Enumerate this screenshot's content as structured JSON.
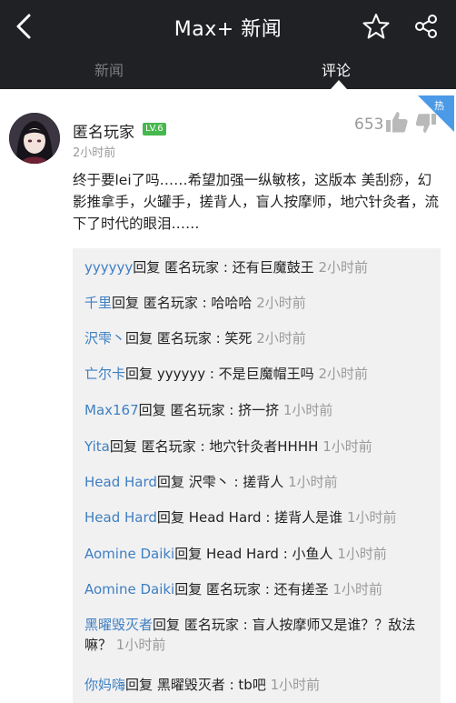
{
  "header": {
    "title": "Max+ 新闻",
    "tabs": [
      {
        "label": "新闻",
        "active": false
      },
      {
        "label": "评论",
        "active": true
      }
    ]
  },
  "comment": {
    "author": "匿名玩家",
    "level": "LV.6",
    "time": "2小时前",
    "likes": "653",
    "hot_label": "热",
    "body": "终于要lei了吗……希望加强一纵敏核，这版本 美刮痧，幻影推拿手，火罐手，搓背人，盲人按摩师，地穴针灸者，流下了时代的眼泪……"
  },
  "replies": [
    {
      "from": "yyyyyy",
      "verb": "回复",
      "to": "匿名玩家",
      "text": "还有巨魔鼓王",
      "time": "2小时前"
    },
    {
      "from": "千里",
      "verb": "回复",
      "to": "匿名玩家",
      "text": "哈哈哈",
      "time": "2小时前"
    },
    {
      "from": "沢雫丶",
      "verb": "回复",
      "to": "匿名玩家",
      "text": "笑死",
      "time": "2小时前"
    },
    {
      "from": "亡尔卡",
      "verb": "回复",
      "to": "yyyyyy",
      "text": "不是巨魔帽王吗",
      "time": "2小时前"
    },
    {
      "from": "Max167",
      "verb": "回复",
      "to": "匿名玩家",
      "text": "挤一挤",
      "time": "1小时前"
    },
    {
      "from": "Yita",
      "verb": "回复",
      "to": "匿名玩家",
      "text": "地穴针灸者HHHH",
      "time": "1小时前"
    },
    {
      "from": "Head Hard",
      "verb": "回复",
      "to": "沢雫丶",
      "text": "搓背人",
      "time": "1小时前"
    },
    {
      "from": "Head Hard",
      "verb": "回复",
      "to": "Head Hard",
      "text": "搓背人是谁",
      "time": "1小时前"
    },
    {
      "from": "Aomine Daiki",
      "verb": "回复",
      "to": "Head Hard",
      "text": "小鱼人",
      "time": "1小时前"
    },
    {
      "from": "Aomine Daiki",
      "verb": "回复",
      "to": "匿名玩家",
      "text": "还有搓圣",
      "time": "1小时前"
    },
    {
      "from": "黑曜毁灭者",
      "verb": "回复",
      "to": "匿名玩家",
      "text": "盲人按摩师又是谁？？敌法嘛？",
      "time": "1小时前"
    },
    {
      "from": "你妈嗨",
      "verb": "回复",
      "to": "黑曜毁灭者",
      "text": "tb吧",
      "time": "1小时前"
    }
  ],
  "icons": {
    "back": "chevron-left-icon",
    "favorite": "star-icon",
    "share": "share-icon",
    "like": "thumb-up-icon",
    "dislike": "thumb-down-icon"
  },
  "colors": {
    "header_bg": "#1f2124",
    "link_blue": "#3f7fc1",
    "level_green": "#47b84d",
    "hot_blue": "#4a9ae8",
    "reply_bg": "#f1f1f2"
  }
}
